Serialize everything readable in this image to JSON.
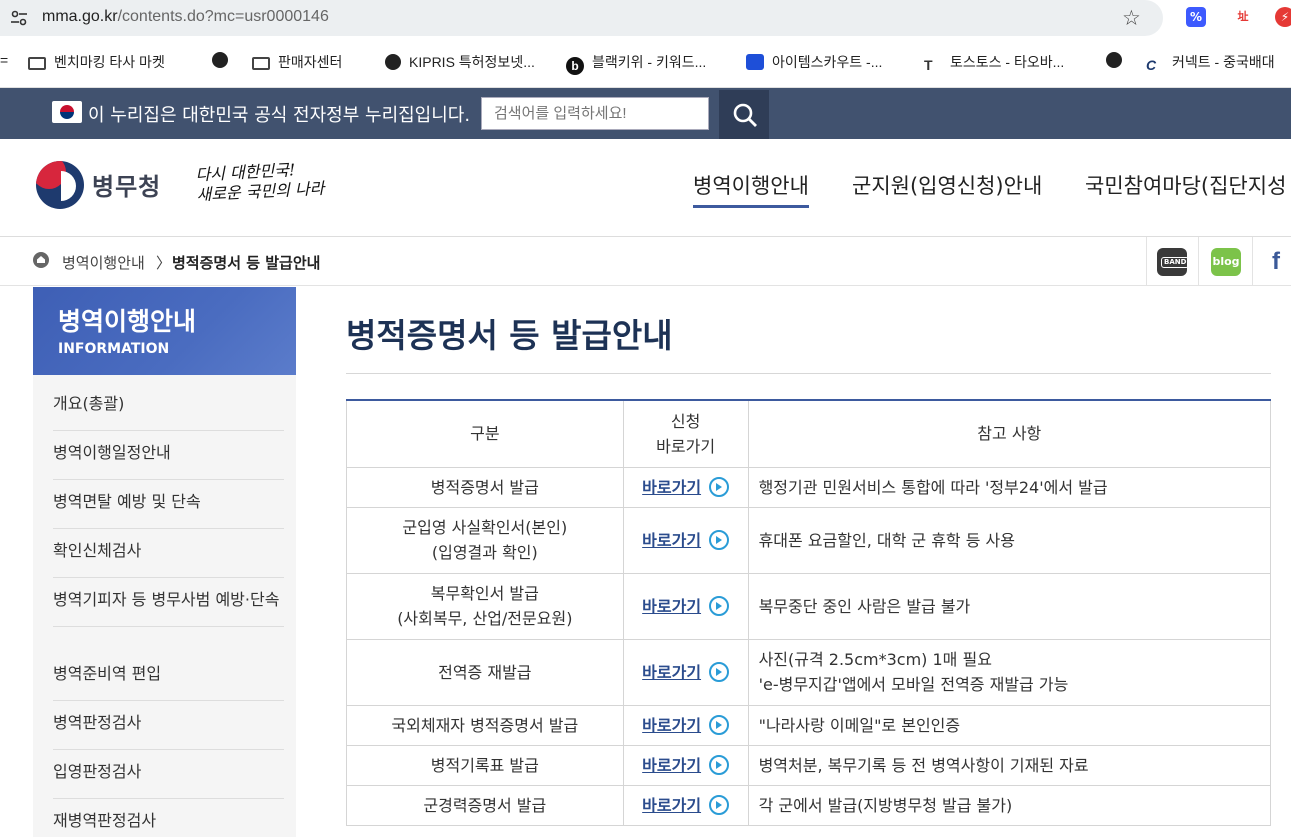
{
  "browser": {
    "url_host": "mma.go.kr",
    "url_path": "/contents.do?mc=usr0000146",
    "bookmarks": [
      {
        "label": "벤치마킹 타사 마켓",
        "icon": "folder-icon"
      },
      {
        "label": "판매자센터",
        "icon": "folder-icon"
      },
      {
        "label": "KIPRIS 특허정보넷...",
        "icon": "globe-icon"
      },
      {
        "label": "블랙키위 - 키워드...",
        "icon": "blackkiwi-icon"
      },
      {
        "label": "아이템스카우트 -...",
        "icon": "itemscout-icon"
      },
      {
        "label": "토스토스 - 타오바...",
        "icon": "tostos-icon"
      },
      {
        "label": "커넥트 - 중국배대",
        "icon": "connect-icon"
      }
    ]
  },
  "gov_banner": {
    "text": "이 누리집은 대한민국 공식 전자정부 누리집입니다.",
    "search_placeholder": "검색어를 입력하세요!"
  },
  "header": {
    "logo_text": "병무청",
    "slogan_line1": "다시 대한민국!",
    "slogan_line2": "새로운 국민의 나라",
    "nav": [
      "병역이행안내",
      "군지원(입영신청)안내",
      "국민참여마당(집단지성"
    ]
  },
  "breadcrumb": {
    "parent": "병역이행안내",
    "separator": "〉",
    "current": "병적증명서 등 발급안내"
  },
  "sidebar": {
    "title": "병역이행안내",
    "subtitle": "INFORMATION",
    "items": [
      {
        "label": "개요(총괄)"
      },
      {
        "label": "병역이행일정안내"
      },
      {
        "label": "병역면탈 예방 및 단속"
      },
      {
        "label": "확인신체검사"
      },
      {
        "label": "병역기피자 등 병무사범 예방·단속"
      },
      {
        "label": "병역준비역 편입"
      },
      {
        "label": "병역판정검사"
      },
      {
        "label": "입영판정검사"
      },
      {
        "label": "재병역판정검사"
      }
    ]
  },
  "main": {
    "title": "병적증명서 등 발급안내",
    "table": {
      "headers": [
        "구분",
        "신청\n바로가기",
        "참고 사항"
      ],
      "go_label": "바로가기",
      "rows": [
        {
          "category": "병적증명서 발급",
          "note": "행정기관 민원서비스 통합에 따라 '정부24'에서 발급"
        },
        {
          "category": "군입영 사실확인서(본인)\n(입영결과 확인)",
          "note": "휴대폰 요금할인, 대학 군 휴학 등 사용"
        },
        {
          "category": "복무확인서 발급\n(사회복무, 산업/전문요원)",
          "note": "복무중단 중인 사람은 발급 불가"
        },
        {
          "category": "전역증 재발급",
          "note": "사진(규격 2.5cm*3cm) 1매 필요\n'e-병무지갑'앱에서 모바일 전역증 재발급 가능"
        },
        {
          "category": "국외체재자 병적증명서 발급",
          "note": "\"나라사랑 이메일\"로 본인인증"
        },
        {
          "category": "병적기록표 발급",
          "note": "병역처분, 복무기록 등 전 병역사항이 기재된 자료"
        },
        {
          "category": "군경력증명서 발급",
          "note": "각 군에서 발급(지방병무청 발급 불가)"
        }
      ]
    }
  },
  "colors": {
    "gov_banner": "#41526f",
    "accent": "#3d5a9e",
    "title": "#1d3255",
    "link": "#2b4c8d",
    "arrow": "#2a9cd7"
  }
}
